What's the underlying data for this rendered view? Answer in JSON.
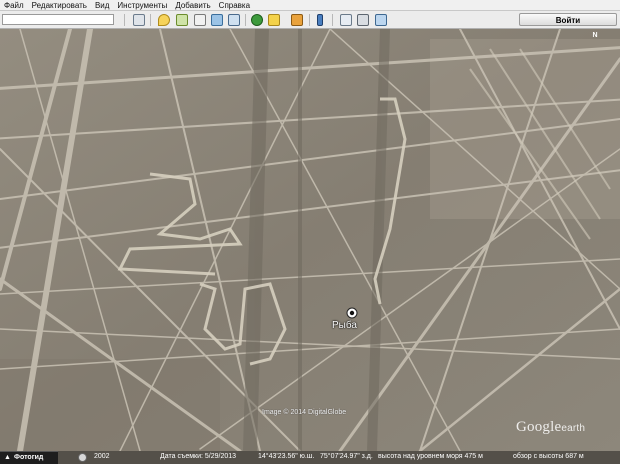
{
  "menu": {
    "items": [
      {
        "label": "Файл"
      },
      {
        "label": "Редактировать"
      },
      {
        "label": "Вид"
      },
      {
        "label": "Инструменты"
      },
      {
        "label": "Добавить"
      },
      {
        "label": "Справка"
      }
    ]
  },
  "toolbar": {
    "login_label": "Войти",
    "icons": [
      "sidebar-icon",
      "placemark-icon",
      "polygon-icon",
      "path-icon",
      "image-overlay-icon",
      "tour-icon",
      "historical-imagery-icon",
      "sun-icon",
      "planets-icon",
      "ruler-icon",
      "email-icon",
      "print-icon",
      "view-in-maps-icon"
    ]
  },
  "map": {
    "compass_label": "N",
    "placemark_label": "Рыба",
    "imagery_credit": "Image © 2014 DigitalGlobe",
    "logo_text": "Google",
    "logo_suffix": "earth"
  },
  "statusbar": {
    "photo_tab_label": "Фотогид",
    "year": "2002",
    "capture_date": "Дата съемки: 5/29/2013",
    "latitude": "14°43'23.56\" ю.ш.",
    "longitude": "75°07'24.97\" з.д.",
    "elevation": "высота над уровнем моря 475 м",
    "eye_altitude": "обзор с высоты 687 м"
  },
  "colors": {
    "ground": "#8a8479",
    "line": "#c9c2b4"
  }
}
